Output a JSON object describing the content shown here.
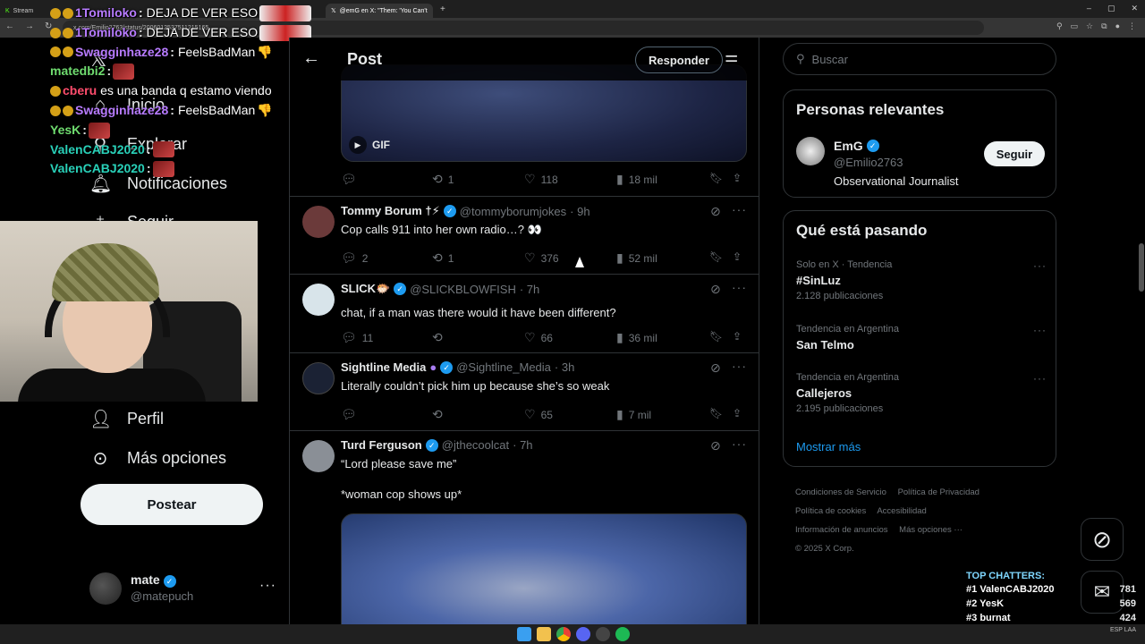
{
  "browser": {
    "tabs": [
      {
        "label": "Stream"
      },
      {
        "label": "@emG en X: \"Them: 'You Can't"
      }
    ],
    "url": "x.com/Emilio2763/status/2006012537511215165"
  },
  "leftnav": {
    "items": [
      {
        "label": "Inicio",
        "icon": "home-icon"
      },
      {
        "label": "Explorar",
        "icon": "search-icon"
      },
      {
        "label": "Notificaciones",
        "icon": "bell-icon"
      },
      {
        "label": "Seguir",
        "icon": "follow-icon"
      },
      {
        "label": "Perfil",
        "icon": "person-icon"
      },
      {
        "label": "Más opciones",
        "icon": "more-circle-icon"
      }
    ],
    "post_button": "Postear",
    "account": {
      "name": "mate",
      "handle": "@matepuch"
    }
  },
  "chat": [
    {
      "user": "1Tomiloko",
      "message": "DEJA DE VER ESO",
      "color": "#b77bff"
    },
    {
      "user": "1Tomiloko",
      "message": "DEJA DE VER ESO",
      "color": "#b77bff"
    },
    {
      "user": "Swagginhaze28",
      "message": "FeelsBadMan",
      "color": "#b77bff"
    },
    {
      "user": "matedbi2",
      "message": "",
      "color": "#6fdc6f"
    },
    {
      "user": "cberu",
      "message": "es una banda q estamo viendo",
      "color": "#ff4d6d"
    },
    {
      "user": "Swagginhaze28",
      "message": "FeelsBadMan",
      "color": "#b77bff"
    },
    {
      "user": "YesK",
      "message": "",
      "color": "#6fdc6f"
    },
    {
      "user": "ValenCABJ2020",
      "message": "",
      "color": "#29d1b9"
    },
    {
      "user": "ValenCABJ2020",
      "message": "",
      "color": "#29d1b9"
    }
  ],
  "main": {
    "title": "Post",
    "reply_button": "Responder",
    "gif_label": "GIF",
    "top_actions": {
      "replies": "",
      "retweets": "1",
      "likes": "118",
      "views": "18 mil"
    },
    "tweets": [
      {
        "name": "Tommy Borum †⚡",
        "handle": "@tommyborumjokes",
        "time": "· 9h",
        "text": "Cop calls 911 into her own radio…? 👀",
        "replies": "2",
        "retweets": "1",
        "likes": "376",
        "views": "52 mil",
        "avatar_color": "#6b3a3a"
      },
      {
        "name": "SLICK🐡",
        "handle": "@SLICKBLOWFISH",
        "time": "· 7h",
        "text": "chat, if a man was there would it have been different?",
        "replies": "11",
        "retweets": "",
        "likes": "66",
        "views": "36 mil",
        "avatar_color": "#d8e4ea"
      },
      {
        "name": "Sightline Media",
        "handle": "@Sightline_Media",
        "time": "· 3h",
        "text": "Literally couldn’t pick him up because she’s so weak",
        "replies": "",
        "retweets": "",
        "likes": "65",
        "views": "7 mil",
        "avatar_color": "#1b2234"
      },
      {
        "name": "Turd Ferguson",
        "handle": "@jthecoolcat",
        "time": "· 7h",
        "text": "“Lord please save me”\n\n*woman cop shows up*",
        "avatar_color": "#8a8f96"
      }
    ]
  },
  "right": {
    "search_placeholder": "Buscar",
    "people": {
      "title": "Personas relevantes",
      "name": "EmG",
      "handle": "@Emilio2763",
      "bio": "Observational Journalist",
      "follow": "Seguir"
    },
    "trends": {
      "title": "Qué está pasando",
      "items": [
        {
          "context": "Solo en X · Tendencia",
          "title": "#SinLuz",
          "count": "2.128 publicaciones"
        },
        {
          "context": "Tendencia en Argentina",
          "title": "San Telmo",
          "count": ""
        },
        {
          "context": "Tendencia en Argentina",
          "title": "Callejeros",
          "count": "2.195 publicaciones"
        }
      ],
      "show_more": "Mostrar más"
    },
    "footer": [
      "Condiciones de Servicio",
      "Política de Privacidad",
      "Política de cookies",
      "Accesibilidad",
      "Información de anuncios",
      "Más opciones ···",
      "© 2025 X Corp."
    ]
  },
  "top_chatters": {
    "title": "TOP CHATTERS:",
    "rows": [
      {
        "rank": "#1",
        "name": "ValenCABJ2020",
        "count": "781"
      },
      {
        "rank": "#2",
        "name": "YesK",
        "count": "569"
      },
      {
        "rank": "#3",
        "name": "burnat",
        "count": "424"
      }
    ]
  },
  "taskbar": {
    "lang": "ESP LAA"
  },
  "colors": {
    "accent": "#1d9bf0",
    "background": "#000000",
    "border": "#2f3336",
    "muted": "#71767b"
  }
}
